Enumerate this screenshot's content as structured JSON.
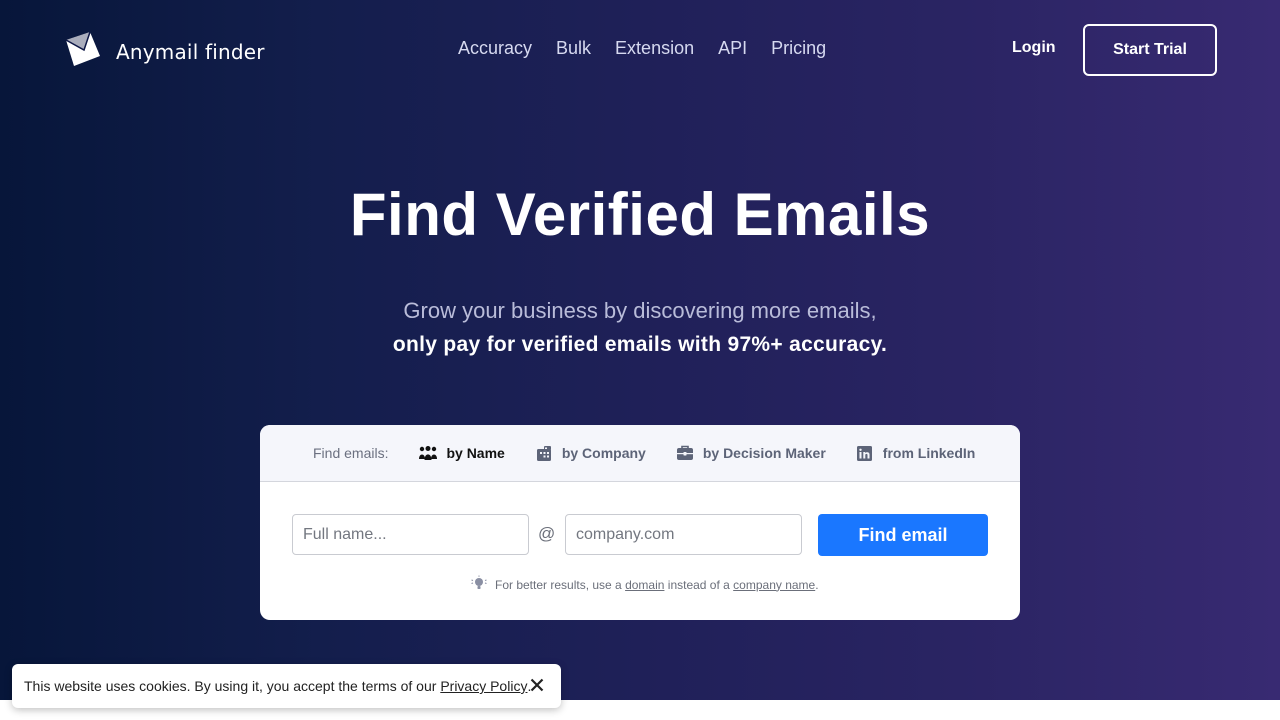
{
  "brand": {
    "name": "Anymail finder",
    "logo_icon": "envelope-icon"
  },
  "nav": {
    "items": [
      {
        "label": "Accuracy"
      },
      {
        "label": "Bulk"
      },
      {
        "label": "Extension"
      },
      {
        "label": "API"
      },
      {
        "label": "Pricing"
      }
    ],
    "login_label": "Login",
    "start_trial_label": "Start Trial"
  },
  "hero": {
    "title": "Find Verified Emails",
    "subtitle_line1": "Grow your business by discovering more emails,",
    "subtitle_line2": "only pay for verified emails with 97%+ accuracy."
  },
  "search": {
    "tabs_label": "Find emails:",
    "tabs": [
      {
        "label": "by Name",
        "icon": "people-icon",
        "active": true
      },
      {
        "label": "by Company",
        "icon": "building-icon",
        "active": false
      },
      {
        "label": "by Decision Maker",
        "icon": "briefcase-icon",
        "active": false
      },
      {
        "label": "from LinkedIn",
        "icon": "linkedin-icon",
        "active": false
      }
    ],
    "name_placeholder": "Full name...",
    "name_value": "",
    "at_sign": "@",
    "domain_placeholder": "company.com",
    "domain_value": "",
    "submit_label": "Find email",
    "hint": {
      "icon": "lightbulb-icon",
      "prefix": "For better results, use a ",
      "link1": "domain",
      "middle": " instead of a ",
      "link2": "company name",
      "suffix": "."
    }
  },
  "cookie_banner": {
    "text": "This website uses cookies. By using it, you accept the terms of our ",
    "link": "Privacy Policy",
    "suffix": ".",
    "close_icon": "close-icon"
  },
  "colors": {
    "accent": "#1a77ff",
    "gradient_start": "#07163a",
    "gradient_end": "#382a72"
  }
}
